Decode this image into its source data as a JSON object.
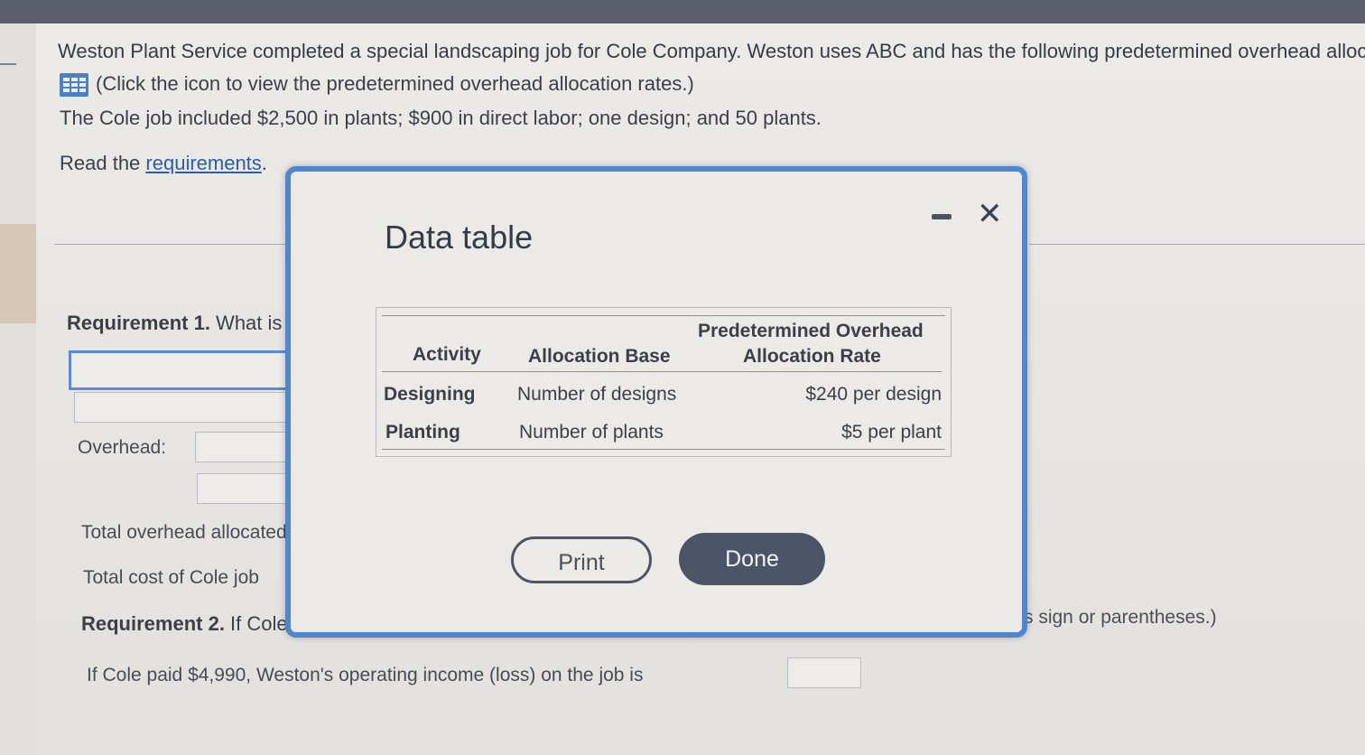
{
  "problem": {
    "intro": "Weston Plant Service completed a special landscaping job for Cole Company. Weston uses ABC and has the following predetermined overhead alloc",
    "click_icon_text": "(Click the icon to view the predetermined overhead allocation rates.)",
    "job_details": "The Cole job included $2,500 in plants; $900 in direct labor; one design; and 50 plants.",
    "read_prefix": "Read the ",
    "read_link": "requirements",
    "read_suffix": "."
  },
  "form": {
    "req1_label": "Requirement 1.",
    "req1_text": " What is",
    "overhead_label": "Overhead:",
    "total_overhead_label": "Total overhead allocated",
    "total_cost_label": "Total cost of Cole job",
    "req2_label": "Requirement 2.",
    "req2_text": " If Cole p",
    "req2_hint": "s sign or parentheses.)",
    "paid_text": "If Cole paid $4,990, Weston's operating income (loss) on the job is"
  },
  "modal": {
    "title": "Data table",
    "headers": {
      "activity": "Activity",
      "allocation_base": "Allocation Base",
      "rate_line1": "Predetermined Overhead",
      "rate_line2": "Allocation Rate"
    },
    "rows": [
      {
        "activity": "Designing",
        "base": "Number of designs",
        "rate": "$240 per design"
      },
      {
        "activity": "Planting",
        "base": "Number of plants",
        "rate": "$5 per plant"
      }
    ],
    "print_label": "Print",
    "done_label": "Done"
  },
  "icons": {
    "table_icon": "table-grid-icon",
    "minimize": "minimize-icon",
    "close": "close-icon"
  },
  "colors": {
    "modal_border": "#4f86d0",
    "link": "#2a5dad",
    "done_button": "#4b5567"
  }
}
